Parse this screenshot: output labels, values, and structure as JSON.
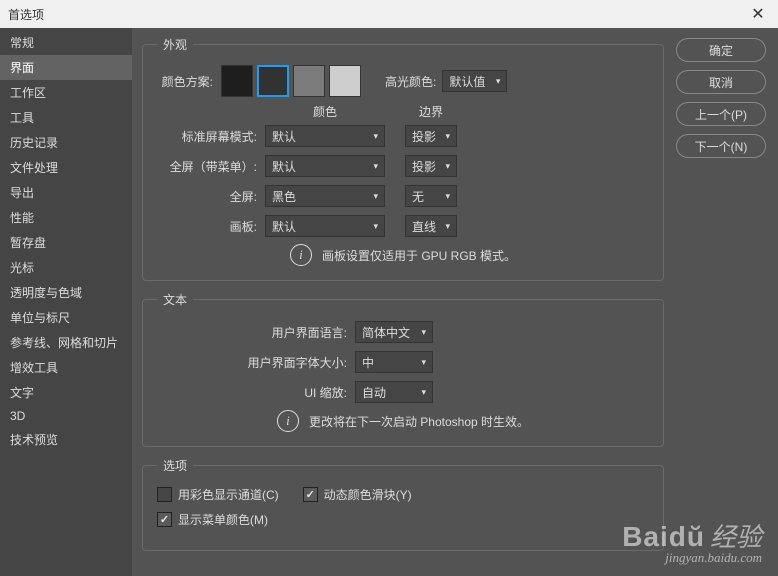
{
  "titlebar": {
    "title": "首选项"
  },
  "sidebar": {
    "items": [
      "常规",
      "界面",
      "工作区",
      "工具",
      "历史记录",
      "文件处理",
      "导出",
      "性能",
      "暂存盘",
      "光标",
      "透明度与色域",
      "单位与标尺",
      "参考线、网格和切片",
      "增效工具",
      "文字",
      "3D",
      "技术预览"
    ],
    "selectedIndex": 1
  },
  "buttons": {
    "ok": "确定",
    "cancel": "取消",
    "prev": "上一个(P)",
    "next": "下一个(N)"
  },
  "appearance": {
    "legend": "外观",
    "colorSchemeLabel": "颜色方案:",
    "swatches": [
      "#1e1e1e",
      "#323232",
      "#7b7b7b",
      "#cecece"
    ],
    "swatchSelected": 1,
    "highlightLabel": "高光颜色:",
    "highlightValue": "默认值",
    "colHeaders": {
      "color": "颜色",
      "border": "边界"
    },
    "rows": [
      {
        "label": "标准屏幕模式:",
        "color": "默认",
        "border": "投影"
      },
      {
        "label": "全屏（带菜单）:",
        "color": "默认",
        "border": "投影"
      },
      {
        "label": "全屏:",
        "color": "黑色",
        "border": "无"
      },
      {
        "label": "画板:",
        "color": "默认",
        "border": "直线"
      }
    ],
    "info": "画板设置仅适用于 GPU RGB 模式。"
  },
  "text": {
    "legend": "文本",
    "rows": [
      {
        "label": "用户界面语言:",
        "value": "简体中文"
      },
      {
        "label": "用户界面字体大小:",
        "value": "中"
      },
      {
        "label": "UI 缩放:",
        "value": "自动"
      }
    ],
    "info": "更改将在下一次启动 Photoshop 时生效。"
  },
  "options": {
    "legend": "选项",
    "items": [
      {
        "label": "用彩色显示通道(C)",
        "checked": false
      },
      {
        "label": "动态颜色滑块(Y)",
        "checked": true
      },
      {
        "label": "显示菜单颜色(M)",
        "checked": true
      }
    ]
  },
  "watermark": {
    "main": "Baid",
    "jing": "经验",
    "sub": "jingyan.baidu.com"
  }
}
